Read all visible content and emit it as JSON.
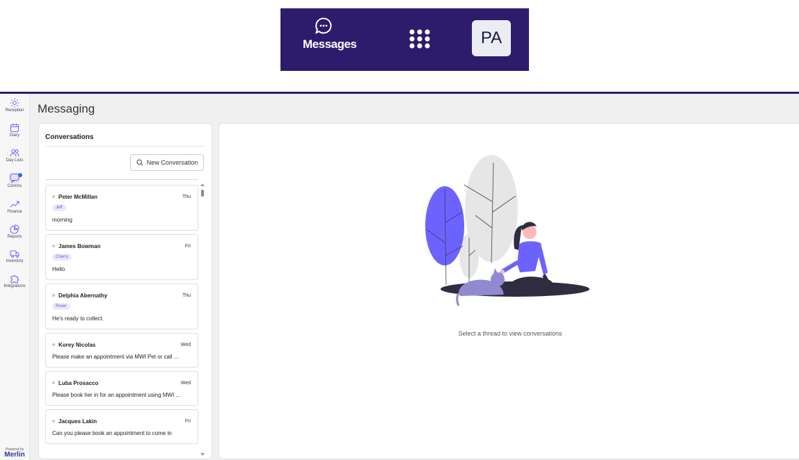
{
  "topbar": {
    "messages_label": "Messages",
    "avatar_initials": "PA",
    "background": "#2d1b6b"
  },
  "sidebar": {
    "items": [
      {
        "label": "Reception",
        "icon": "reception-icon"
      },
      {
        "label": "Diary",
        "icon": "calendar-icon"
      },
      {
        "label": "Day Lists",
        "icon": "users-icon"
      },
      {
        "label": "Comms",
        "icon": "chat-icon",
        "active": true,
        "notification": true
      },
      {
        "label": "Finance",
        "icon": "trend-icon"
      },
      {
        "label": "Reports",
        "icon": "pie-chart-icon"
      },
      {
        "label": "Inventory",
        "icon": "truck-icon"
      },
      {
        "label": "Integrations",
        "icon": "puzzle-icon"
      }
    ],
    "powered_by": "Powered by",
    "brand": "Merlin"
  },
  "page": {
    "title": "Messaging"
  },
  "conversations": {
    "heading": "Conversations",
    "new_button": "New Conversation",
    "items": [
      {
        "name": "Peter McMillan",
        "day": "Thu",
        "tag": "Jeff",
        "message": "morning"
      },
      {
        "name": "James Bowman",
        "day": "Fri",
        "tag": "Cherry",
        "message": "Hello"
      },
      {
        "name": "Delphia Abernathy",
        "day": "Thu",
        "tag": "Rover",
        "message": "He's ready to collect."
      },
      {
        "name": "Korey Nicolas",
        "day": "Wed",
        "tag": "",
        "message": "Please make an appointment via MWI Pet or call ..."
      },
      {
        "name": "Luba Prosacco",
        "day": "Wed",
        "tag": "",
        "message": "Please book her in for an appointment using MWI ..."
      },
      {
        "name": "Jacques Lakin",
        "day": "Fri",
        "tag": "",
        "message": "Can you please book an appointment to come in"
      }
    ]
  },
  "thread": {
    "empty_message": "Select a thread to view conversations"
  },
  "colors": {
    "accent": "#6c63ff",
    "brand": "#2d1b6b"
  }
}
